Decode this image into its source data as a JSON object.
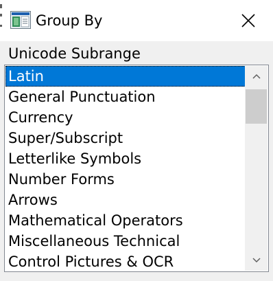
{
  "window": {
    "title": "Group By",
    "close_icon": "close-icon",
    "app_icon": "character-map-icon"
  },
  "group_label": "Unicode Subrange",
  "subranges": {
    "selected_index": 0,
    "items": [
      {
        "label": "Latin"
      },
      {
        "label": "General Punctuation"
      },
      {
        "label": "Currency"
      },
      {
        "label": "Super/Subscript"
      },
      {
        "label": "Letterlike Symbols"
      },
      {
        "label": "Number Forms"
      },
      {
        "label": "Arrows"
      },
      {
        "label": "Mathematical Operators"
      },
      {
        "label": "Miscellaneous Technical"
      },
      {
        "label": "Control Pictures & OCR"
      }
    ]
  },
  "scrollbar": {
    "up_icon": "chevron-up-icon",
    "down_icon": "chevron-down-icon",
    "position": 0.1
  },
  "colors": {
    "selection": "#0078d7",
    "selection_text": "#ffffff",
    "dialog_background": "#f0f0f0",
    "scroll_thumb": "#cdcdcd"
  }
}
